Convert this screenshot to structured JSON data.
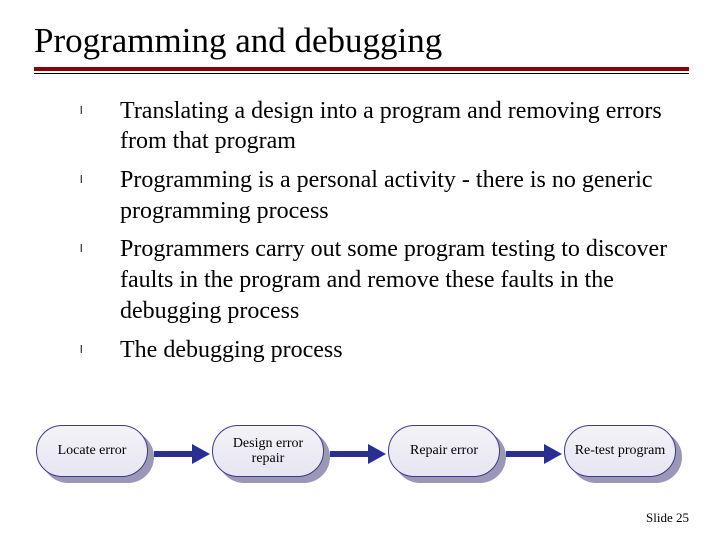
{
  "title": "Programming and debugging",
  "bullets": [
    "Translating a design into a program and removing errors from that program",
    "Programming is a personal activity - there is no generic programming process",
    "Programmers carry out some program testing to discover faults in the program and remove these faults in the debugging process",
    "The debugging process"
  ],
  "chart_data": {
    "type": "diagram",
    "nodes": [
      "Locate error",
      "Design error repair",
      "Repair error",
      "Re-test program"
    ]
  },
  "footer": {
    "label": "Slide",
    "number": "25"
  }
}
